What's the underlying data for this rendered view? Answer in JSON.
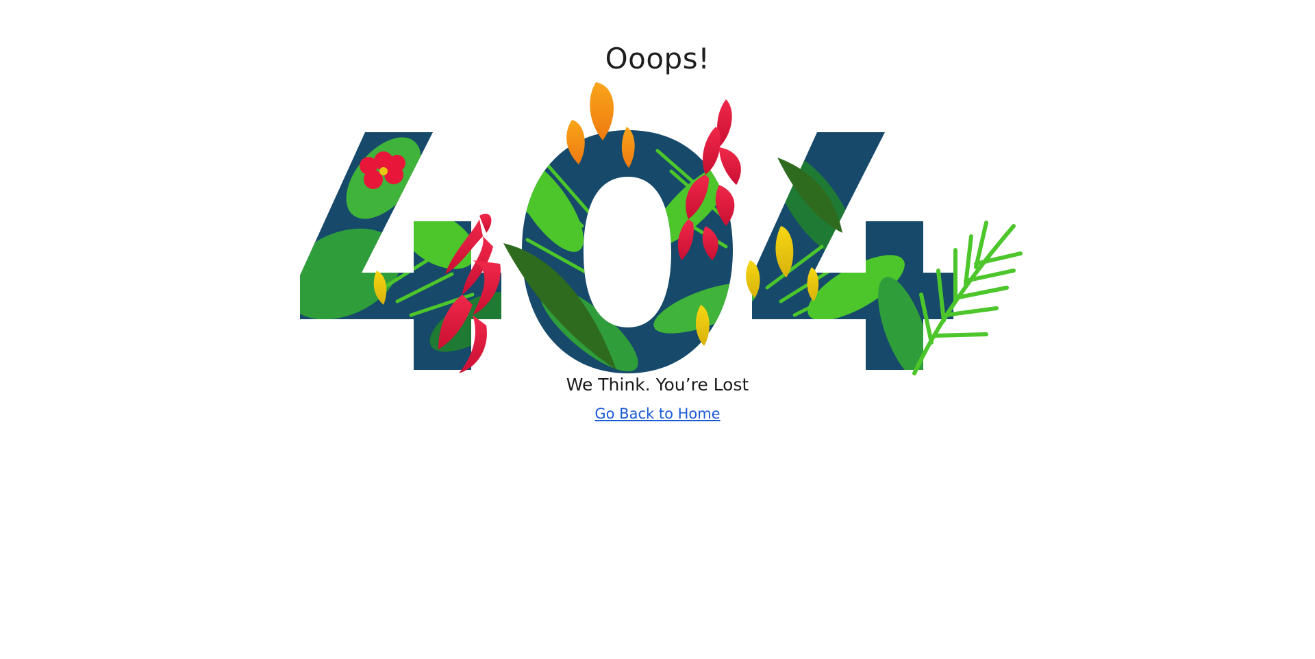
{
  "page": {
    "title": "Ooops!",
    "subtitle": "We Think. You’re Lost",
    "home_link_label": "Go Back to Home"
  },
  "illustration": {
    "text": "404",
    "icon": "tropical-404-illustration",
    "colors": {
      "digit_fill": "#16496a",
      "leaf_dark": "#1f7a34",
      "leaf_mid": "#2f9e3a",
      "leaf_light": "#4cc62b",
      "flower_red": "#e8173a",
      "flower_orange": "#f48a13",
      "flower_yellow": "#e9c712"
    }
  },
  "colors": {
    "link": "#1a5bd6",
    "text": "#1e1e1e",
    "background": "#ffffff"
  }
}
